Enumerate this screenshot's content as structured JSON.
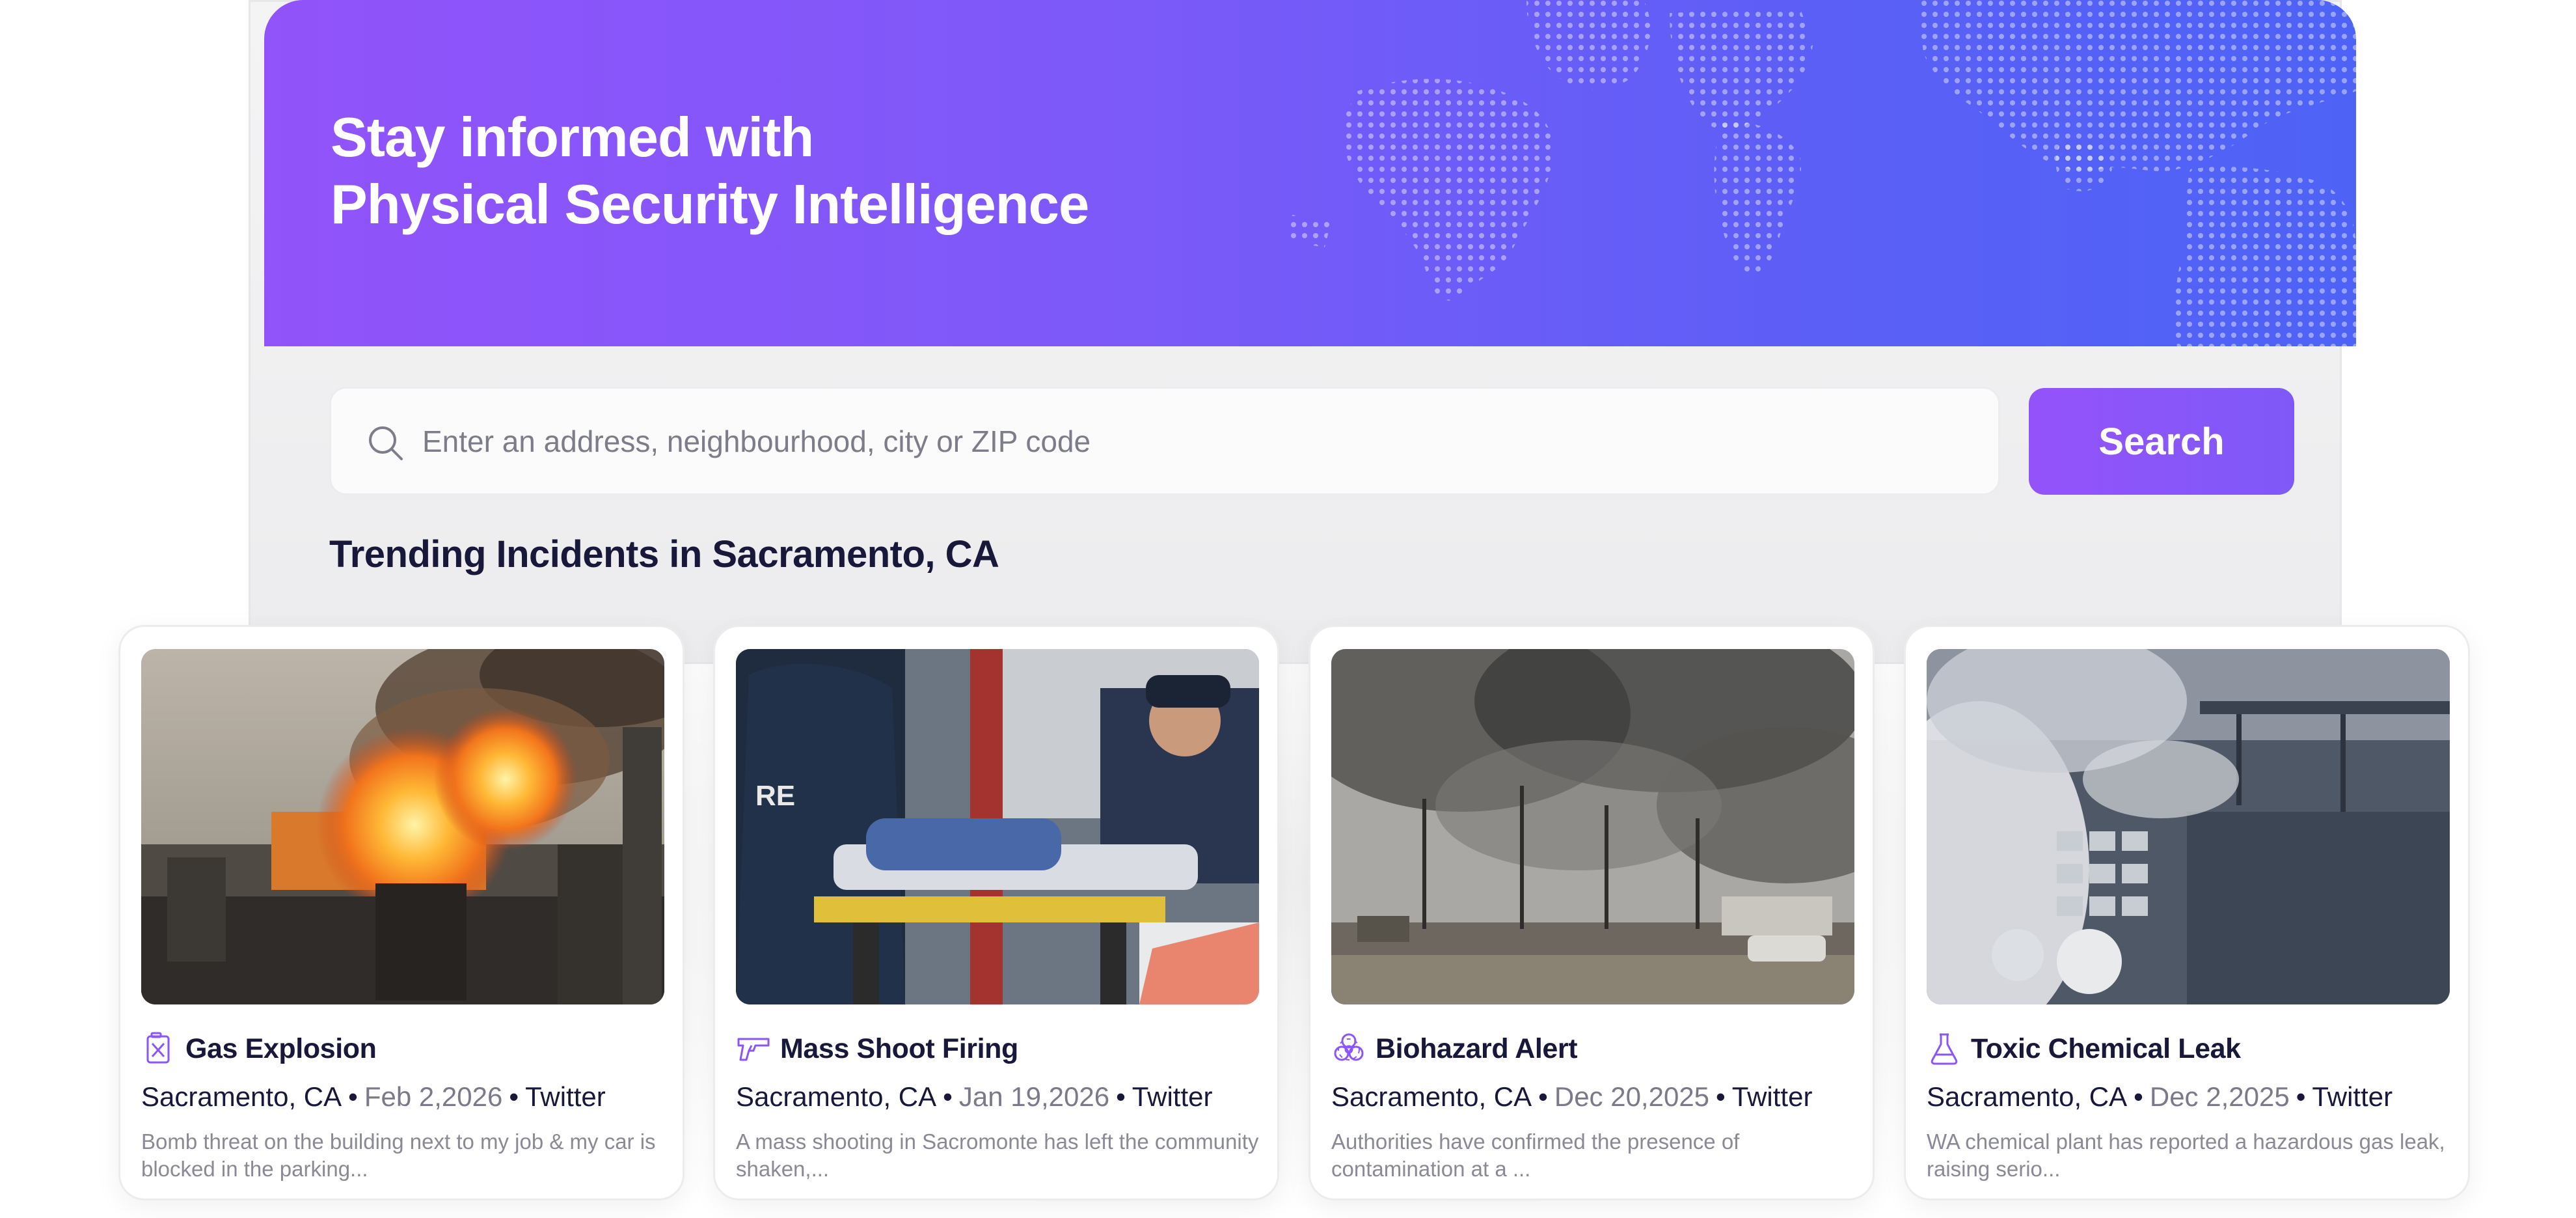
{
  "hero": {
    "title_line1": "Stay informed with",
    "title_line2": "Physical Security Intelligence"
  },
  "search": {
    "placeholder": "Enter an address, neighbourhood, city or ZIP code",
    "value": "",
    "button_label": "Search"
  },
  "section": {
    "title": "Trending Incidents in Sacramento, CA"
  },
  "cards": [
    {
      "icon": "gas-canister-icon",
      "title": "Gas Explosion",
      "location": "Sacramento, CA",
      "separator": "•",
      "date": "Feb 2,2026",
      "source": "Twitter",
      "description": "Bomb threat on the building next to my job & my car is blocked in the parking..."
    },
    {
      "icon": "gun-icon",
      "title": "Mass Shoot Firing",
      "location": "Sacramento, CA",
      "separator": "•",
      "date": "Jan 19,2026",
      "source": "Twitter",
      "description": "A mass shooting in Sacromonte has left the community shaken,..."
    },
    {
      "icon": "biohazard-icon",
      "title": "Biohazard Alert",
      "location": "Sacramento, CA",
      "separator": "•",
      "date": "Dec 20,2025",
      "source": "Twitter",
      "description": "Authorities have confirmed the presence of contamination at a ..."
    },
    {
      "icon": "flask-icon",
      "title": "Toxic Chemical Leak",
      "location": "Sacramento, CA",
      "separator": "•",
      "date": "Dec 2,2025",
      "source": "Twitter",
      "description": "WA chemical plant has reported a hazardous gas leak, raising serio..."
    }
  ],
  "colors": {
    "accent": "#8b55fa",
    "hero_start": "#9153fa",
    "hero_end": "#4e63f6",
    "heading": "#17183a",
    "muted": "#7a7a88"
  }
}
